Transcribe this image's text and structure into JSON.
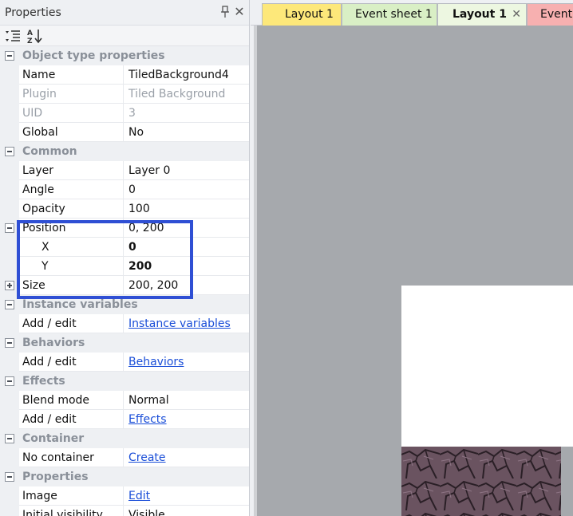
{
  "panel": {
    "title": "Properties",
    "toolbar": {
      "categorized_icon": "categorized-list-icon",
      "alphabetical_icon": "sort-az-icon"
    }
  },
  "sections": {
    "object_type": {
      "label": "Object type properties",
      "name": {
        "label": "Name",
        "value": "TiledBackground4"
      },
      "plugin": {
        "label": "Plugin",
        "value": "Tiled Background"
      },
      "uid": {
        "label": "UID",
        "value": "3"
      },
      "global": {
        "label": "Global",
        "value": "No"
      }
    },
    "common": {
      "label": "Common",
      "layer": {
        "label": "Layer",
        "value": "Layer 0"
      },
      "angle": {
        "label": "Angle",
        "value": "0"
      },
      "opacity": {
        "label": "Opacity",
        "value": "100"
      },
      "position": {
        "label": "Position",
        "value": "0, 200"
      },
      "x": {
        "label": "X",
        "value": "0"
      },
      "y": {
        "label": "Y",
        "value": "200"
      },
      "size": {
        "label": "Size",
        "value": "200, 200"
      }
    },
    "instance_variables": {
      "label": "Instance variables",
      "add": {
        "label": "Add / edit",
        "link": "Instance variables"
      }
    },
    "behaviors": {
      "label": "Behaviors",
      "add": {
        "label": "Add / edit",
        "link": "Behaviors"
      }
    },
    "effects": {
      "label": "Effects",
      "blend": {
        "label": "Blend mode",
        "value": "Normal"
      },
      "add": {
        "label": "Add / edit",
        "link": "Effects"
      }
    },
    "container": {
      "label": "Container",
      "none": {
        "label": "No container",
        "link": "Create"
      }
    },
    "properties": {
      "label": "Properties",
      "image": {
        "label": "Image",
        "link": "Edit"
      },
      "initial_visibility": {
        "label": "Initial visibility",
        "value": "Visible"
      }
    }
  },
  "tabs": [
    {
      "label": "Layout 1",
      "color": "#fde87a"
    },
    {
      "label": "Event sheet 1",
      "color": "#d9efc5"
    },
    {
      "label": "Layout 1",
      "color": "#edf7e1",
      "active": true
    },
    {
      "label": "Event",
      "color": "#f7b0b0"
    }
  ],
  "colors": {
    "highlight": "#2f4fd4",
    "link": "#1a4ed8",
    "canvas": "#a6a9ad"
  }
}
